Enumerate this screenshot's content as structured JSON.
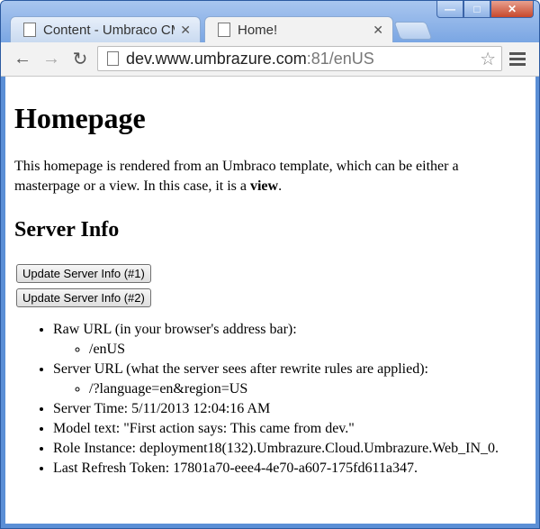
{
  "browser": {
    "tabs": [
      {
        "title": "Content - Umbraco CMS",
        "active": false
      },
      {
        "title": "Home!",
        "active": true
      }
    ],
    "url_host": "dev.www.umbrazure.com",
    "url_rest": ":81/enUS"
  },
  "page": {
    "heading": "Homepage",
    "description_before": "This homepage is rendered from an Umbraco template, which can be either a masterpage or a view. In this case, it is a ",
    "description_bold": "view",
    "description_after": ".",
    "server_heading": "Server Info",
    "buttons": [
      "Update Server Info (#1)",
      "Update Server Info (#2)"
    ],
    "info": {
      "raw_url_label": "Raw URL (in your browser's address bar):",
      "raw_url_value": "/enUS",
      "server_url_label": "Server URL (what the server sees after rewrite rules are applied):",
      "server_url_value": "/?language=en&region=US",
      "server_time": "Server Time: 5/11/2013 12:04:16 AM",
      "model_text": "Model text: \"First action says: This came from dev.\"",
      "role_instance": "Role Instance: deployment18(132).Umbrazure.Cloud.Umbrazure.Web_IN_0.",
      "refresh_token": "Last Refresh Token: 17801a70-eee4-4e70-a607-175fd611a347."
    }
  }
}
